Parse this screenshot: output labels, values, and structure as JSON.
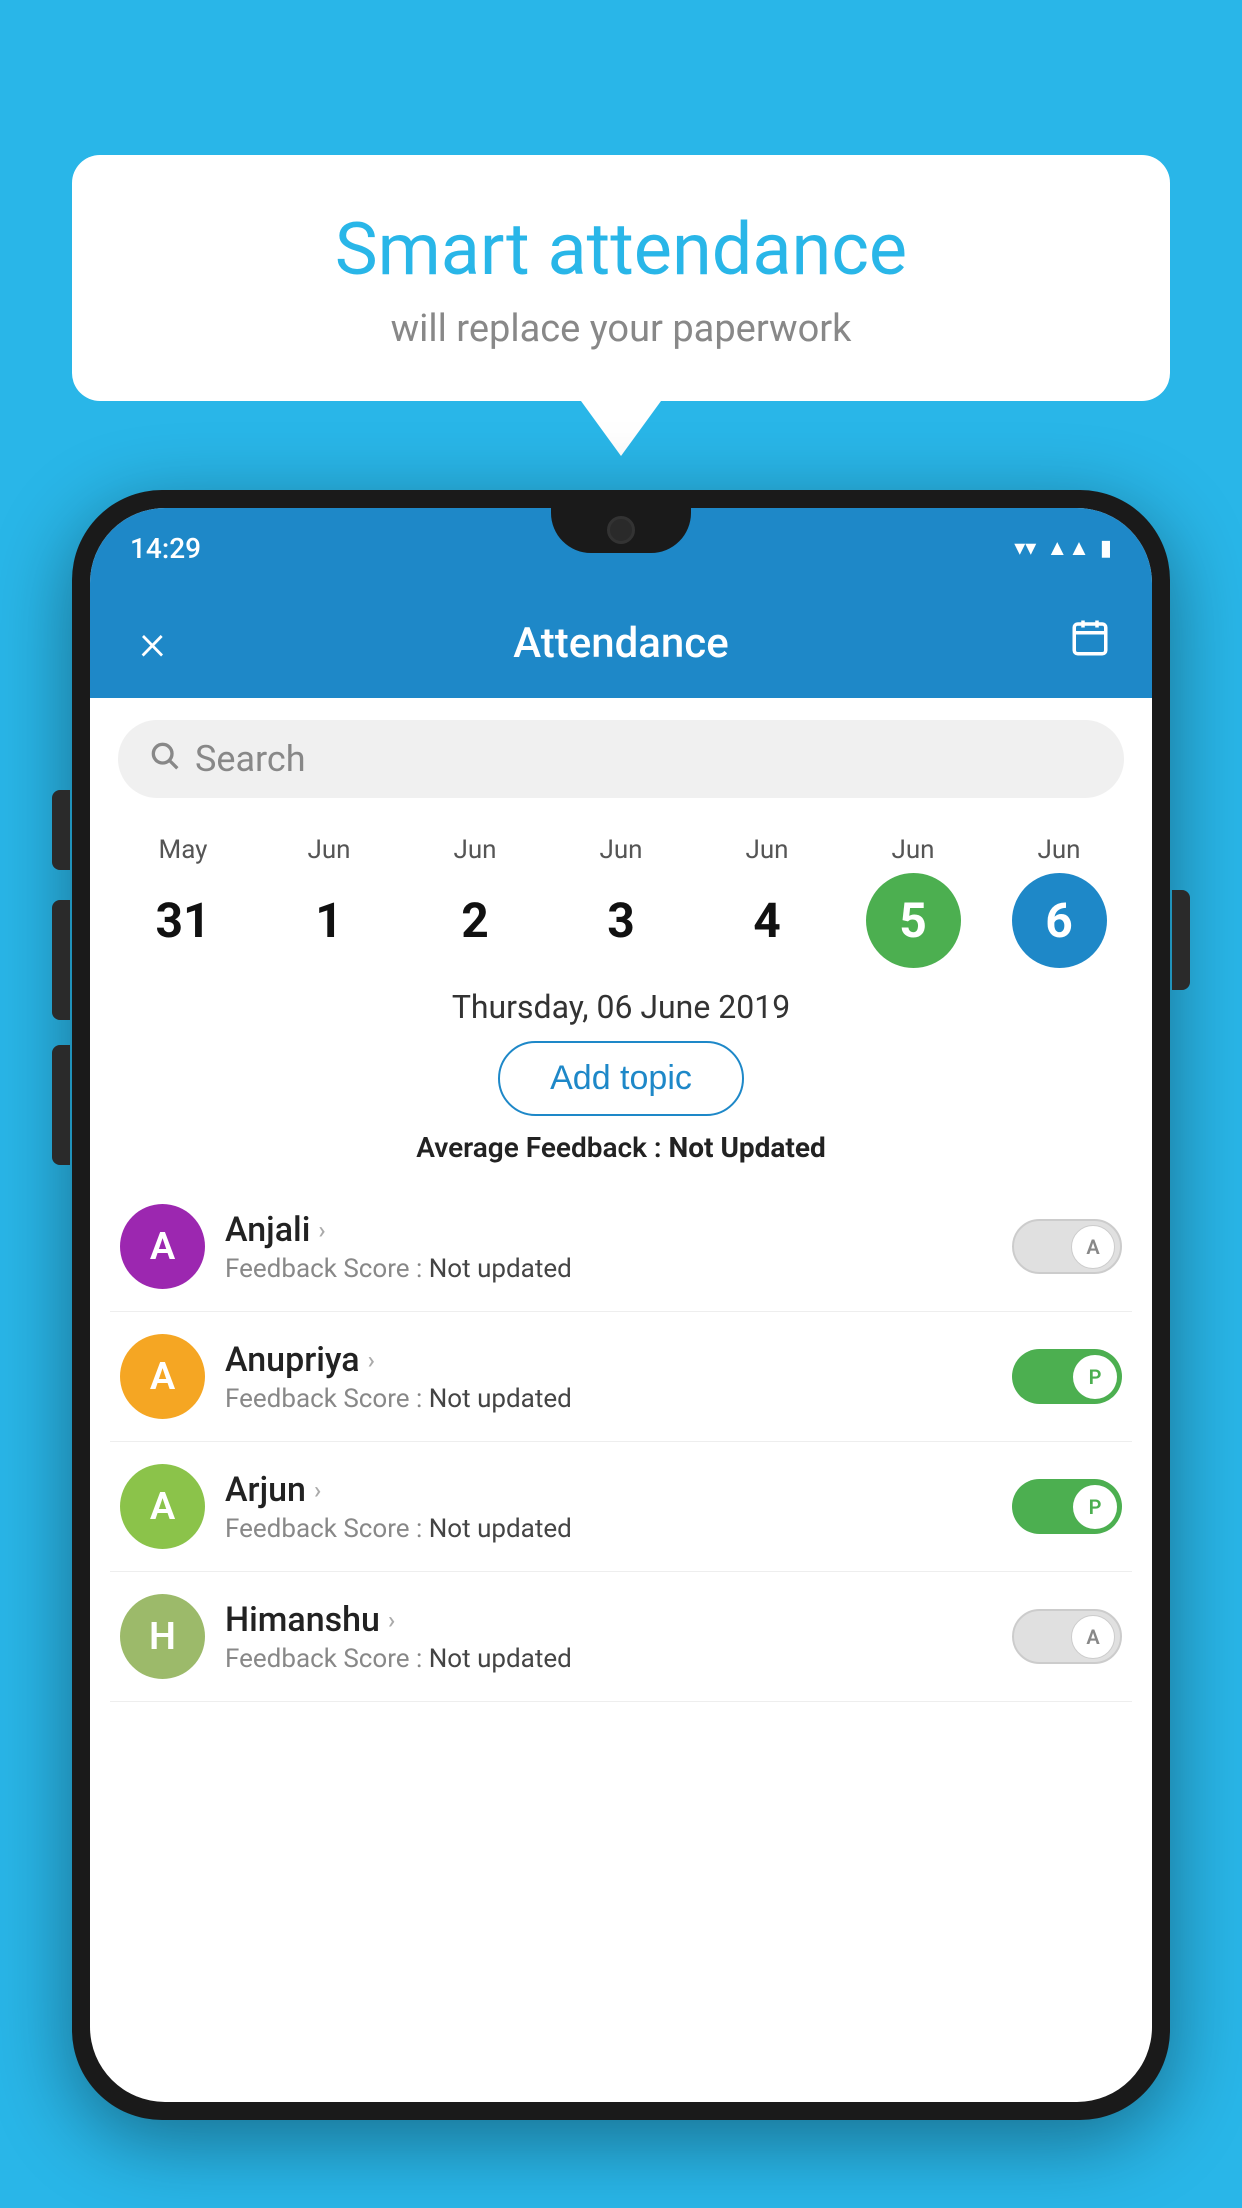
{
  "background_color": "#29b6e8",
  "speech_bubble": {
    "title": "Smart attendance",
    "subtitle": "will replace your paperwork"
  },
  "status_bar": {
    "time": "14:29",
    "icons": [
      "wifi",
      "signal",
      "battery"
    ]
  },
  "app_bar": {
    "title": "Attendance",
    "close_label": "×",
    "calendar_label": "📅"
  },
  "search": {
    "placeholder": "Search"
  },
  "calendar": {
    "days": [
      {
        "month": "May",
        "date": "31",
        "selected": ""
      },
      {
        "month": "Jun",
        "date": "1",
        "selected": ""
      },
      {
        "month": "Jun",
        "date": "2",
        "selected": ""
      },
      {
        "month": "Jun",
        "date": "3",
        "selected": ""
      },
      {
        "month": "Jun",
        "date": "4",
        "selected": ""
      },
      {
        "month": "Jun",
        "date": "5",
        "selected": "green"
      },
      {
        "month": "Jun",
        "date": "6",
        "selected": "blue"
      }
    ]
  },
  "selected_date_label": "Thursday, 06 June 2019",
  "add_topic_button": "Add topic",
  "average_feedback": {
    "label": "Average Feedback : ",
    "value": "Not Updated"
  },
  "students": [
    {
      "name": "Anjali",
      "avatar_letter": "A",
      "avatar_color": "#9c27b0",
      "feedback_label": "Feedback Score : ",
      "feedback_value": "Not updated",
      "toggle_state": "off",
      "toggle_label": "A"
    },
    {
      "name": "Anupriya",
      "avatar_letter": "A",
      "avatar_color": "#f5a623",
      "feedback_label": "Feedback Score : ",
      "feedback_value": "Not updated",
      "toggle_state": "on",
      "toggle_label": "P"
    },
    {
      "name": "Arjun",
      "avatar_letter": "A",
      "avatar_color": "#8bc34a",
      "feedback_label": "Feedback Score : ",
      "feedback_value": "Not updated",
      "toggle_state": "on",
      "toggle_label": "P"
    },
    {
      "name": "Himanshu",
      "avatar_letter": "H",
      "avatar_color": "#9cba6a",
      "feedback_label": "Feedback Score : ",
      "feedback_value": "Not updated",
      "toggle_state": "off",
      "toggle_label": "A"
    }
  ]
}
